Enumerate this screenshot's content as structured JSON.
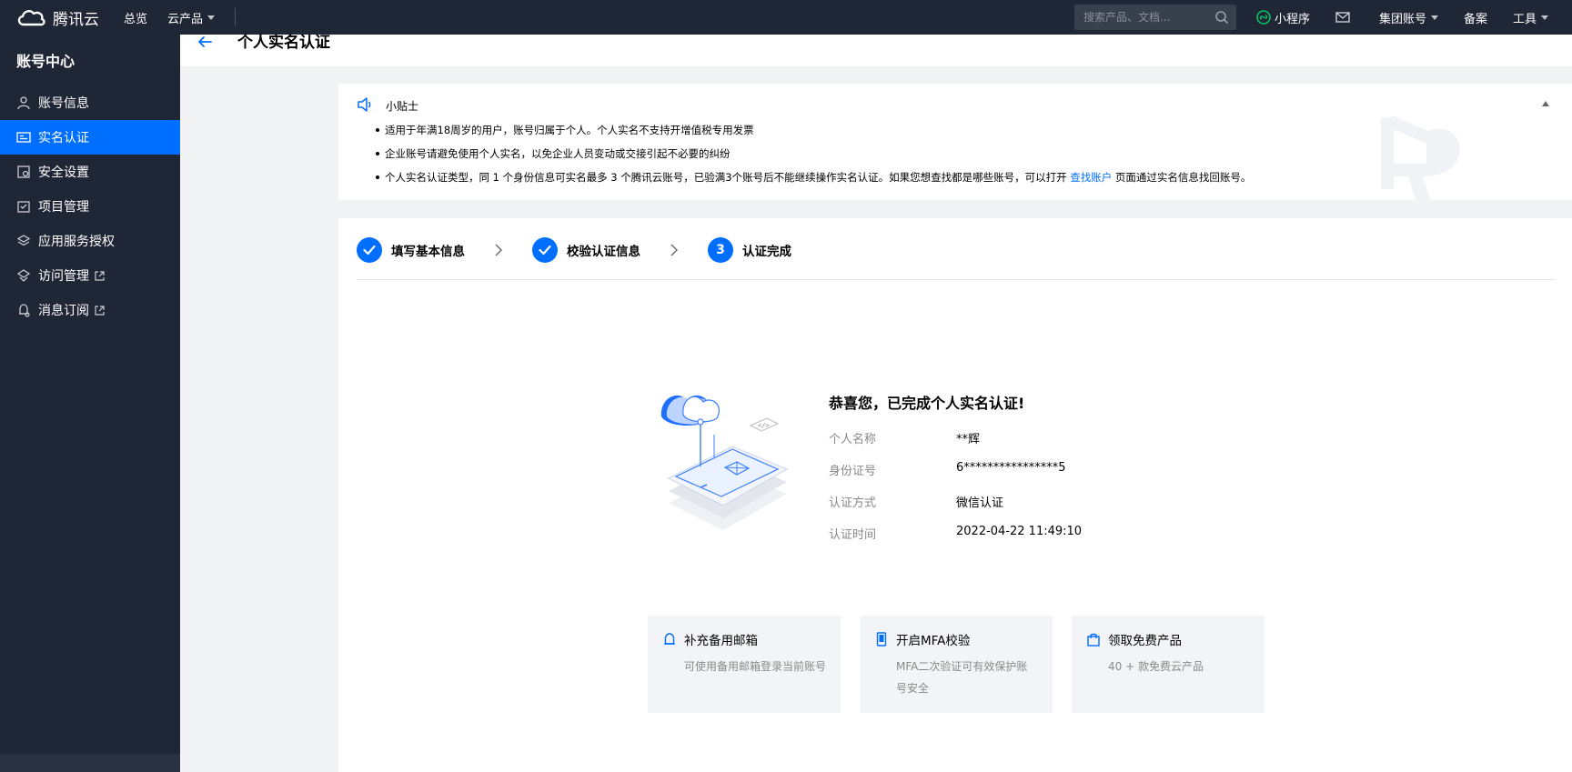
{
  "topbar": {
    "brand": "腾讯云",
    "nav": [
      {
        "label": "总览"
      },
      {
        "label": "云产品"
      }
    ],
    "search_placeholder": "搜索产品、文档...",
    "right": {
      "miniprogram": "小程序",
      "group_account": "集团账号",
      "record": "备案",
      "tools": "工具"
    }
  },
  "sidebar": {
    "title": "账号中心",
    "items": [
      {
        "label": "账号信息"
      },
      {
        "label": "实名认证"
      },
      {
        "label": "安全设置"
      },
      {
        "label": "项目管理"
      },
      {
        "label": "应用服务授权"
      },
      {
        "label": "访问管理"
      },
      {
        "label": "消息订阅"
      }
    ]
  },
  "header": {
    "title": "个人实名认证"
  },
  "tips": {
    "title": "小贴士",
    "items": [
      "适用于年满18周岁的用户，账号归属于个人。个人实名不支持开增值税专用发票",
      "企业账号请避免使用个人实名，以免企业人员变动或交接引起不必要的纠纷"
    ],
    "third_prefix": "个人实名认证类型，同 1 个身份信息可实名最多 3 个腾讯云账号，已验满3个账号后不能继续操作实名认证。如果您想查找都是哪些账号，可以打开 ",
    "third_link": "查找账户",
    "third_suffix": " 页面通过实名信息找回账号。"
  },
  "steps": [
    {
      "label": "填写基本信息",
      "status": "done"
    },
    {
      "label": "校验认证信息",
      "status": "done"
    },
    {
      "label": "认证完成",
      "number": "3",
      "status": "current"
    }
  ],
  "result": {
    "title": "恭喜您，已完成个人实名认证!",
    "rows": [
      {
        "key": "个人名称",
        "value": "**辉"
      },
      {
        "key": "身份证号",
        "value": "6****************5"
      },
      {
        "key": "认证方式",
        "value": "微信认证"
      },
      {
        "key": "认证时间",
        "value": "2022-04-22 11:49:10"
      }
    ]
  },
  "features": [
    {
      "title": "补充备用邮箱",
      "desc": "可使用备用邮箱登录当前账号"
    },
    {
      "title": "开启MFA校验",
      "desc": "MFA二次验证可有效保护账号安全"
    },
    {
      "title": "领取免费产品",
      "desc": "40 + 款免费云产品"
    }
  ],
  "colors": {
    "accent": "#006eff",
    "nav_bg": "#1f2635",
    "page_bg": "#f2f3f5"
  }
}
